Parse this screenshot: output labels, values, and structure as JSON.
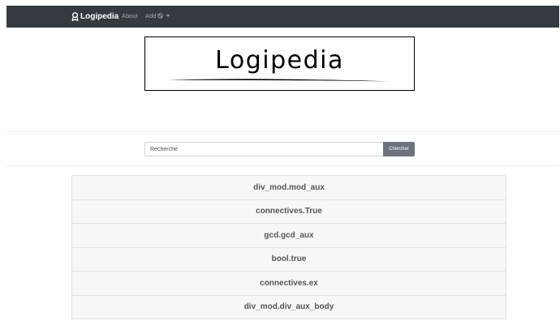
{
  "navbar": {
    "brand": "Logipedia",
    "links": [
      {
        "label": "About"
      },
      {
        "label": "Add"
      }
    ],
    "icons": {
      "brand": "award-icon",
      "add": "block-icon",
      "dropdown": "caret-down-icon"
    },
    "background": "#343a40"
  },
  "logo": {
    "text": "Logipedia"
  },
  "search": {
    "placeholder": "Recherche",
    "button_label": "Chercher"
  },
  "results": [
    "div_mod.mod_aux",
    "connectives.True",
    "gcd.gcd_aux",
    "bool.true",
    "connectives.ex",
    "div_mod.div_aux_body"
  ]
}
